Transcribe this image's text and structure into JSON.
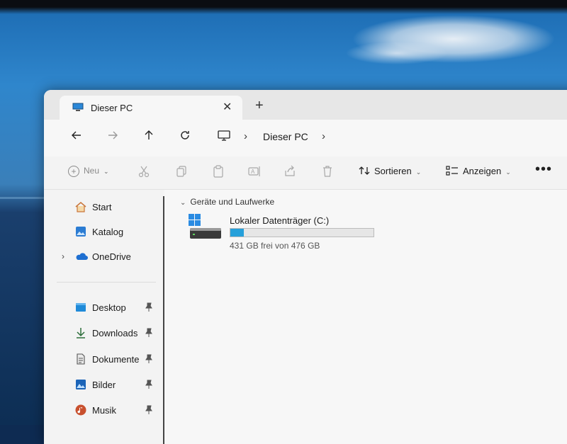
{
  "window": {
    "tab_title": "Dieser PC",
    "new_tab_symbol": "+",
    "close_symbol": "✕"
  },
  "navigation": {
    "back_icon": "arrow-left-icon",
    "forward_icon": "arrow-right-icon",
    "up_icon": "arrow-up-icon",
    "refresh_icon": "refresh-icon",
    "address": {
      "location": "Dieser PC"
    }
  },
  "toolbar": {
    "new_label": "Neu",
    "sort_label": "Sortieren",
    "view_label": "Anzeigen",
    "more_symbol": "•••",
    "icons": [
      "cut-icon",
      "copy-icon",
      "paste-icon",
      "rename-icon",
      "share-icon",
      "delete-icon"
    ]
  },
  "sidebar": {
    "top_items": [
      {
        "label": "Start",
        "icon": "home-icon"
      },
      {
        "label": "Katalog",
        "icon": "gallery-icon"
      },
      {
        "label": "OneDrive",
        "icon": "cloud-icon"
      }
    ],
    "pinned_items": [
      {
        "label": "Desktop",
        "icon": "desktop-icon"
      },
      {
        "label": "Downloads",
        "icon": "download-icon"
      },
      {
        "label": "Dokumente",
        "icon": "document-icon"
      },
      {
        "label": "Bilder",
        "icon": "pictures-icon"
      },
      {
        "label": "Musik",
        "icon": "music-icon"
      }
    ]
  },
  "content": {
    "group_title": "Geräte und Laufwerke",
    "drive": {
      "name": "Lokaler Datenträger (C:)",
      "free_text": "431 GB frei von 476 GB",
      "used_fraction": 0.095
    }
  },
  "colors": {
    "accent": "#26a0da",
    "window_bg": "#f4f4f4"
  }
}
